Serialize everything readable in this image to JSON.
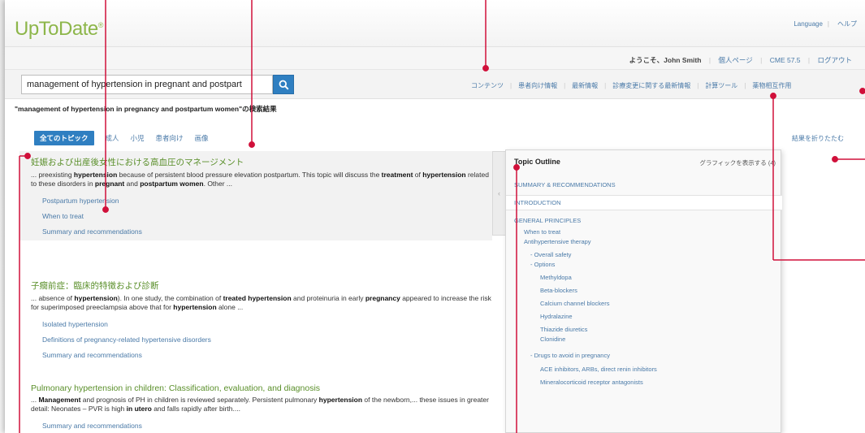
{
  "header": {
    "logo": "UpToDate",
    "logo_mark": "®",
    "language": "Language",
    "help": "ヘルプ"
  },
  "userbar": {
    "welcome": "ようこそ、John Smith",
    "mypage": "個人ページ",
    "cme": "CME 57.5",
    "logout": "ログアウト"
  },
  "search": {
    "value": "management of hypertension in pregnant and postpart"
  },
  "nav": {
    "items": [
      "コンテンツ",
      "患者向け情報",
      "最新情報",
      "診療変更に関する最新情報",
      "計算ツール",
      "薬物相互作用"
    ]
  },
  "results_header": "\"management of hypertension in pregnancy and postpartum women\"の検索結果",
  "filters": {
    "active": "全てのトピック",
    "others": [
      "成人",
      "小児",
      "患者向け",
      "画像"
    ]
  },
  "collapse_link": "結果を折りたたむ",
  "results": [
    {
      "title": "妊娠および出産後女性における高血圧のマネージメント",
      "snippet_pre": "... preexisting ",
      "snippet_b1": "hypertension",
      "snippet_mid1": " because of persistent blood pressure elevation postpartum. This topic will discuss the ",
      "snippet_b2": "treatment",
      "snippet_mid2": " of ",
      "snippet_b3": "hypertension",
      "snippet_mid3": " related to these disorders in ",
      "snippet_b4": "pregnant",
      "snippet_mid4": " and ",
      "snippet_b5": "postpartum women",
      "snippet_end": ". Other ...",
      "links": [
        "Postpartum hypertension",
        "When to treat",
        "Summary and recommendations"
      ]
    },
    {
      "title": "子癇前症：臨床的特徴および診断",
      "snippet_pre": "... absence of ",
      "snippet_b1": "hypertension",
      "snippet_mid1": "). In one study, the combination of ",
      "snippet_b2": "treated hypertension",
      "snippet_mid2": " and proteinuria in early ",
      "snippet_b3": "pregnancy",
      "snippet_mid3": " appeared to increase the risk for superimposed preeclampsia above that for ",
      "snippet_b4": "hypertension",
      "snippet_end": " alone ...",
      "links": [
        "Isolated hypertension",
        "Definitions of pregnancy-related hypertensive disorders",
        "Summary and recommendations"
      ]
    },
    {
      "title": "Pulmonary hypertension in children: Classification, evaluation, and diagnosis",
      "snippet_pre": "... ",
      "snippet_b1": "Management",
      "snippet_mid1": " and prognosis of PH in children is reviewed separately. Persistent pulmonary ",
      "snippet_b2": "hypertension",
      "snippet_mid2": " of the newborn,... these issues in greater detail: Neonates – PVR is high ",
      "snippet_b3": "in utero",
      "snippet_end": " and falls rapidly after birth....",
      "links": [
        "Summary and recommendations"
      ]
    }
  ],
  "outline": {
    "title": "Topic Outline",
    "graphics": "グラフィックを表示する (4)",
    "sections": [
      "SUMMARY & RECOMMENDATIONS",
      "INTRODUCTION",
      "GENERAL PRINCIPLES"
    ],
    "items": [
      "When to treat",
      "Antihypertensive therapy",
      "- Overall safety",
      "- Options",
      "Methyldopa",
      "Beta-blockers",
      "Calcium channel blockers",
      "Hydralazine",
      "Thiazide diuretics",
      "Clonidine",
      "- Drugs to avoid in pregnancy",
      "ACE inhibitors, ARBs, direct renin inhibitors",
      "Mineralocorticoid receptor antagonists"
    ]
  },
  "colors": {
    "accent_blue": "#2f7fc1",
    "brand_green": "#8db64a",
    "callout_red": "#d0103a"
  }
}
